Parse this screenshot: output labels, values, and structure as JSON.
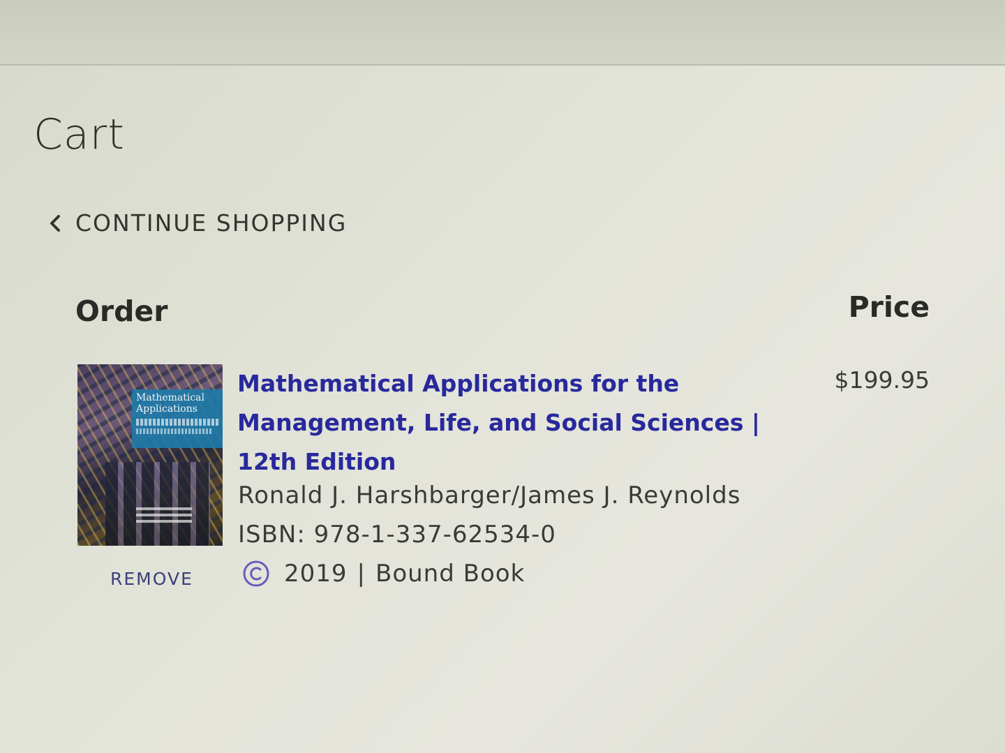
{
  "page": {
    "title": "Cart"
  },
  "nav": {
    "continue_label": "CONTINUE SHOPPING",
    "back_icon": "chevron-left-icon"
  },
  "table": {
    "order_header": "Order",
    "price_header": "Price"
  },
  "item": {
    "title": "Mathematical Applications for the Management, Life, and Social Sciences | 12th Edition",
    "authors": "Ronald J. Harshbarger/James J. Reynolds",
    "isbn": "ISBN: 978-1-337-62534-0",
    "year": "2019",
    "separator": "|",
    "format": "Bound Book",
    "price": "$199.95",
    "remove_label": "REMOVE",
    "cover": {
      "title": "Mathematical Applications"
    }
  },
  "colors": {
    "title_link": "#28299c",
    "remove_link": "#3b3f7a",
    "copyright_icon": "#6a5bb8",
    "text": "#3a3b37"
  }
}
